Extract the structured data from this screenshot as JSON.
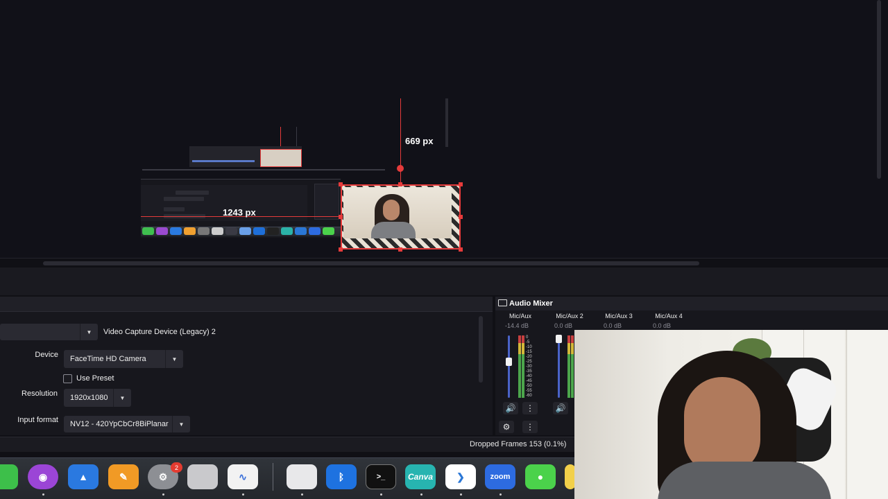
{
  "preview": {
    "measure_height": "669 px",
    "measure_width": "1243 px"
  },
  "properties": {
    "source_name": "Video Capture Device (Legacy) 2",
    "device_label": "Device",
    "device_value": "FaceTime HD Camera",
    "use_preset_label": "Use Preset",
    "resolution_label": "Resolution",
    "resolution_value": "1920x1080",
    "input_format_label": "Input format",
    "input_format_value": "NV12 - 420YpCbCr8BiPlanar"
  },
  "audio_mixer": {
    "title": "Audio Mixer",
    "channels": [
      {
        "name": "Mic/Aux",
        "db": "-14.4 dB"
      },
      {
        "name": "Mic/Aux 2",
        "db": "0.0 dB"
      },
      {
        "name": "Mic/Aux 3",
        "db": "0.0 dB"
      },
      {
        "name": "Mic/Aux 4",
        "db": "0.0 dB"
      }
    ],
    "scale": [
      "0",
      "-5",
      "-10",
      "-15",
      "-20",
      "-25",
      "-30",
      "-35",
      "-40",
      "-45",
      "-50",
      "-55",
      "-60"
    ],
    "mic_aux_fader_level": 0.58
  },
  "status": {
    "dropped_frames": "Dropped Frames 153 (0.1%)"
  },
  "dock": {
    "badge_count": "2",
    "canva_label": "Canva",
    "zoom_label": "zoom",
    "terminal_label": ">_"
  },
  "icons": {
    "speaker": "speaker-icon",
    "kebab": "kebab-menu-icon",
    "gear": "gear-icon",
    "checkbox": "checkbox-unchecked"
  },
  "colors": {
    "accent_red": "#e63b3b",
    "fader_blue": "#4a63c8",
    "panel_bg": "#17171d"
  }
}
